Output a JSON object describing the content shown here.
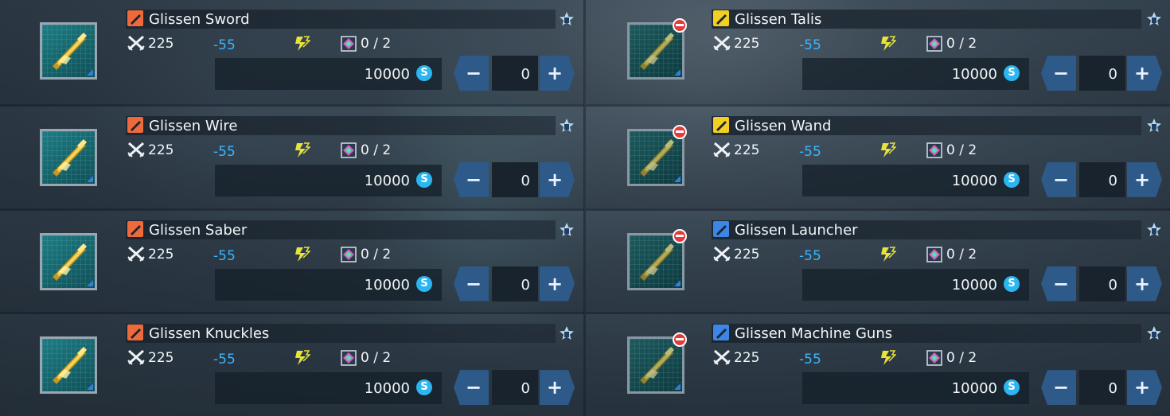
{
  "colors": {
    "negative_value": "#3ab6ff",
    "button_blue": "#2e5a8a",
    "coin_blue": "#2bb6f2",
    "restricted_red": "#e23b3b"
  },
  "columns": [
    {
      "items": [
        {
          "name": "Glissen Sword",
          "type_icon": "sword-icon",
          "type_color": "#ef6a3a",
          "restricted": false,
          "attack": "225",
          "modifier": "-55",
          "slots": "0 / 2",
          "price": "10000",
          "quantity": "0"
        },
        {
          "name": "Glissen Wire",
          "type_icon": "wire-icon",
          "type_color": "#ef6a3a",
          "restricted": false,
          "attack": "225",
          "modifier": "-55",
          "slots": "0 / 2",
          "price": "10000",
          "quantity": "0"
        },
        {
          "name": "Glissen Saber",
          "type_icon": "saber-icon",
          "type_color": "#ef6a3a",
          "restricted": false,
          "attack": "225",
          "modifier": "-55",
          "slots": "0 / 2",
          "price": "10000",
          "quantity": "0"
        },
        {
          "name": "Glissen Knuckles",
          "type_icon": "knuckles-icon",
          "type_color": "#ef6a3a",
          "restricted": false,
          "attack": "225",
          "modifier": "-55",
          "slots": "0 / 2",
          "price": "10000",
          "quantity": "0"
        }
      ]
    },
    {
      "items": [
        {
          "name": "Glissen Talis",
          "type_icon": "talis-icon",
          "type_color": "#f2d023",
          "restricted": true,
          "attack": "225",
          "modifier": "-55",
          "slots": "0 / 2",
          "price": "10000",
          "quantity": "0"
        },
        {
          "name": "Glissen Wand",
          "type_icon": "wand-icon",
          "type_color": "#f2d023",
          "restricted": true,
          "attack": "225",
          "modifier": "-55",
          "slots": "0 / 2",
          "price": "10000",
          "quantity": "0"
        },
        {
          "name": "Glissen Launcher",
          "type_icon": "launcher-icon",
          "type_color": "#3b86e6",
          "restricted": true,
          "attack": "225",
          "modifier": "-55",
          "slots": "0 / 2",
          "price": "10000",
          "quantity": "0"
        },
        {
          "name": "Glissen Machine Guns",
          "type_icon": "machine-guns-icon",
          "type_color": "#3b86e6",
          "restricted": true,
          "attack": "225",
          "modifier": "-55",
          "slots": "0 / 2",
          "price": "10000",
          "quantity": "0"
        }
      ]
    }
  ],
  "controls": {
    "minus_label": "−",
    "plus_label": "+",
    "currency_symbol": "S"
  }
}
